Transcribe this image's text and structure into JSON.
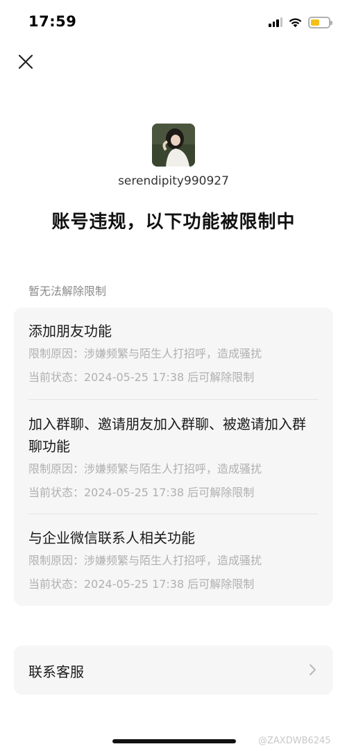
{
  "status_bar": {
    "time": "17:59"
  },
  "profile": {
    "username": "serendipity990927"
  },
  "title": "账号违规，以下功能被限制中",
  "section_label": "暂无法解除限制",
  "restrictions": [
    {
      "title": "添加朋友功能",
      "reason": "限制原因：涉嫌频繁与陌生人打招呼，造成骚扰",
      "status": "当前状态：2024-05-25 17:38 后可解除限制"
    },
    {
      "title": "加入群聊、邀请朋友加入群聊、被邀请加入群聊功能",
      "reason": "限制原因：涉嫌频繁与陌生人打招呼，造成骚扰",
      "status": "当前状态：2024-05-25 17:38 后可解除限制"
    },
    {
      "title": "与企业微信联系人相关功能",
      "reason": "限制原因：涉嫌频繁与陌生人打招呼，造成骚扰",
      "status": "当前状态：2024-05-25 17:38 后可解除限制"
    }
  ],
  "contact": {
    "label": "联系客服"
  },
  "watermark": "@ZAXDWB6245",
  "colors": {
    "battery": "#f2c21b",
    "card_bg": "#f6f6f6",
    "meta_text": "#b0b0b0"
  },
  "icons": [
    "cellular-signal-icon",
    "wifi-icon",
    "battery-icon",
    "close-icon",
    "chevron-right-icon"
  ]
}
